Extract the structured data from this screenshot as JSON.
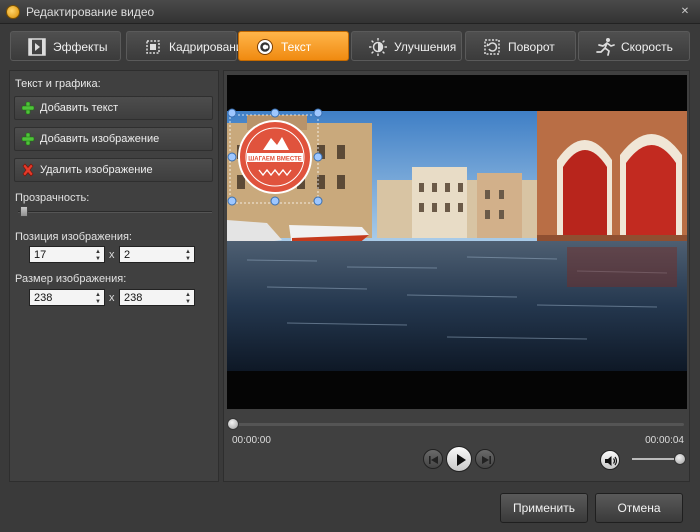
{
  "window": {
    "title": "Редактирование видео"
  },
  "tabs": [
    {
      "label": "Эффекты",
      "icon": "effects-icon"
    },
    {
      "label": "Кадрирование",
      "icon": "crop-icon"
    },
    {
      "label": "Текст",
      "icon": "text-icon",
      "active": true
    },
    {
      "label": "Улучшения",
      "icon": "brightness-icon"
    },
    {
      "label": "Поворот",
      "icon": "rotate-icon"
    },
    {
      "label": "Скорость",
      "icon": "speed-icon"
    }
  ],
  "left": {
    "section_title": "Текст и графика:",
    "add_text": "Добавить текст",
    "add_image": "Добавить изображение",
    "delete_image": "Удалить изображение",
    "opacity_label": "Прозрачность:",
    "position_label": "Позиция изображения:",
    "position_x": "17",
    "position_y": "2",
    "size_label": "Размер изображения:",
    "size_w": "238",
    "size_h": "238",
    "times_sign": "x"
  },
  "overlay": {
    "logo_text": "ШАГАЕМ ВМЕСТЕ"
  },
  "player": {
    "time_current": "00:00:00",
    "time_total": "00:00:04"
  },
  "footer": {
    "apply": "Применить",
    "cancel": "Отмена"
  },
  "colors": {
    "accent": "#f5a02a",
    "logo": "#e0533d"
  }
}
